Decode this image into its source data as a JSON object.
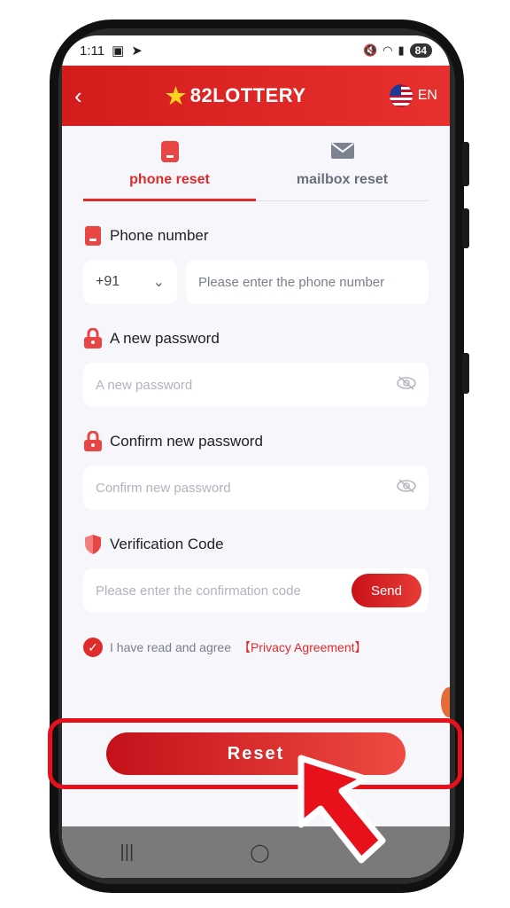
{
  "status_bar": {
    "time": "1:11",
    "battery": "84"
  },
  "header": {
    "logo_text": "82LOTTERY",
    "lang": "EN",
    "back_icon": "chevron-left-icon"
  },
  "tabs": [
    {
      "label": "phone reset",
      "icon": "phone-icon",
      "active": true
    },
    {
      "label": "mailbox reset",
      "icon": "mail-icon",
      "active": false
    }
  ],
  "form": {
    "phone_label": "Phone number",
    "country_code": "+91",
    "phone_placeholder": "Please enter the phone number",
    "new_password_label": "A new password",
    "new_password_placeholder": "A new password",
    "confirm_label": "Confirm new password",
    "confirm_placeholder": "Confirm new password",
    "verify_label": "Verification Code",
    "verify_placeholder": "Please enter the confirmation code",
    "send_label": "Send"
  },
  "agreement": {
    "text": "I have read and agree",
    "link": "【Privacy Agreement】",
    "checked": true
  },
  "reset_label": "Reset",
  "colors": {
    "accent": "#e02b2b",
    "header": "#d31c1c"
  }
}
